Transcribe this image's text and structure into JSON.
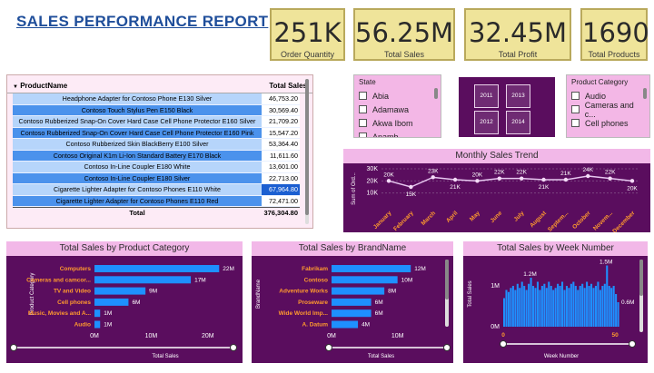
{
  "title": "SALES PERFORMANCE REPORT",
  "kpis": [
    {
      "value": "251K",
      "label": "Order Quantity"
    },
    {
      "value": "56.25M",
      "label": "Total Sales"
    },
    {
      "value": "32.45M",
      "label": "Total Profit"
    },
    {
      "value": "1690",
      "label": "Total Products"
    }
  ],
  "table": {
    "headers": [
      "ProductName",
      "Total Sales"
    ],
    "rows": [
      [
        "Headphone Adapter for Contoso Phone E130 Silver",
        "46,753.20"
      ],
      [
        "Contoso Touch Stylus Pen E150 Black",
        "30,569.40"
      ],
      [
        "Contoso Rubberized Snap-On Cover Hard Case Cell Phone Protector E160 Silver",
        "21,709.20"
      ],
      [
        "Contoso Rubberized Snap-On Cover Hard Case Cell Phone Protector E160 Pink",
        "15,547.20"
      ],
      [
        "Contoso Rubberized Skin BlackBerry E100 Silver",
        "53,364.40"
      ],
      [
        "Contoso Original K1m Li-Ion Standard Battery E170 Black",
        "11,611.60"
      ],
      [
        "Contoso In-Line Coupler E180 White",
        "13,601.00"
      ],
      [
        "Contoso In-Line Coupler E180 Silver",
        "22,713.00"
      ],
      [
        "Cigarette Lighter Adapter for Contoso Phones E110 White",
        "67,964.80"
      ],
      [
        "Cigarette Lighter Adapter for Contoso Phones E110 Red",
        "72,471.00"
      ]
    ],
    "total_label": "Total",
    "total_value": "376,304.80",
    "colors": {
      "dark": "#4b92ec",
      "light": "#b6d5fb",
      "highlight": "#1b5fd1"
    }
  },
  "state_slicer": {
    "title": "State",
    "options": [
      "Abia",
      "Adamawa",
      "Akwa Ibom",
      "Anamb"
    ]
  },
  "years": [
    "2011",
    "2013",
    "2012",
    "2014"
  ],
  "category_slicer": {
    "title": "Product Category",
    "options": [
      "Audio",
      "Cameras and c...",
      "Cell phones"
    ]
  },
  "monthly": {
    "title": "Monthly Sales Trend",
    "ylabel": "Sum of Ord...",
    "yticks": [
      "30K",
      "20K",
      "10K"
    ],
    "months": [
      "January",
      "February",
      "March",
      "April",
      "May",
      "June",
      "July",
      "August",
      "Septem...",
      "October",
      "Novem...",
      "December"
    ],
    "values": [
      20,
      15,
      23,
      21,
      20,
      22,
      22,
      21,
      21,
      24,
      22,
      20
    ],
    "labels": [
      "20K",
      "15K",
      "23K",
      "21K",
      "20K",
      "22K",
      "22K",
      "21K",
      "21K",
      "24K",
      "22K",
      "20K"
    ],
    "ylim": [
      0,
      30
    ]
  },
  "chart_data": [
    {
      "type": "bar",
      "title": "Total Sales by Product Category",
      "xlabel": "Total Sales",
      "ylabel": "Product Category",
      "categories": [
        "Computers",
        "Cameras and camcor...",
        "TV and Video",
        "Cell phones",
        "Music, Movies and A...",
        "Audio"
      ],
      "values": [
        22,
        17,
        9,
        6,
        1,
        1
      ],
      "labels": [
        "22M",
        "17M",
        "9M",
        "6M",
        "1M",
        "1M"
      ],
      "xticks": [
        "0M",
        "10M",
        "20M"
      ],
      "xlim": [
        0,
        25
      ]
    },
    {
      "type": "bar",
      "title": "Total Sales by BrandName",
      "xlabel": "Total Sales",
      "ylabel": "BrandName",
      "categories": [
        "Fabrikam",
        "Contoso",
        "Adventure Works",
        "Proseware",
        "Wide World Imp...",
        "A. Datum"
      ],
      "values": [
        12,
        10,
        8,
        6,
        6,
        4
      ],
      "labels": [
        "12M",
        "10M",
        "8M",
        "6M",
        "6M",
        "4M"
      ],
      "xticks": [
        "0M",
        "10M"
      ],
      "xlim": [
        0,
        15
      ]
    },
    {
      "type": "bar",
      "title": "Total Sales by Week Number",
      "xlabel": "Week Number",
      "ylabel": "Total Sales",
      "xticks": [
        "0",
        "50"
      ],
      "yticks": [
        "1M",
        "0M"
      ],
      "annotations": [
        "1.5M",
        "1.2M",
        "0.6M"
      ],
      "values": [
        0.7,
        0.9,
        0.85,
        0.95,
        1.0,
        0.9,
        1.05,
        0.95,
        1.1,
        1.0,
        0.9,
        1.05,
        1.2,
        1.0,
        0.95,
        1.1,
        0.9,
        1.0,
        1.05,
        0.95,
        1.1,
        1.0,
        0.9,
        0.95,
        1.05,
        1.0,
        1.1,
        0.9,
        1.0,
        0.95,
        1.05,
        1.1,
        1.0,
        0.9,
        1.0,
        1.05,
        0.95,
        1.1,
        1.0,
        1.05,
        0.95,
        1.0,
        1.1,
        0.9,
        1.0,
        1.05,
        1.5,
        1.0,
        0.95,
        1.0,
        0.8,
        0.6
      ],
      "ylim": [
        0,
        1.6
      ]
    }
  ]
}
